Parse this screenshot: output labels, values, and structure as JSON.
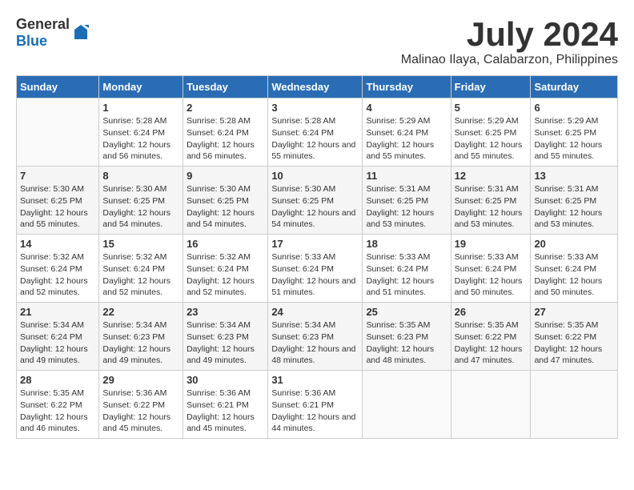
{
  "header": {
    "logo": {
      "general": "General",
      "blue": "Blue"
    },
    "title": "July 2024",
    "subtitle": "Malinao Ilaya, Calabarzon, Philippines"
  },
  "calendar": {
    "days_of_week": [
      "Sunday",
      "Monday",
      "Tuesday",
      "Wednesday",
      "Thursday",
      "Friday",
      "Saturday"
    ],
    "weeks": [
      [
        {
          "day": "",
          "sunrise": "",
          "sunset": "",
          "daylight": ""
        },
        {
          "day": "1",
          "sunrise": "Sunrise: 5:28 AM",
          "sunset": "Sunset: 6:24 PM",
          "daylight": "Daylight: 12 hours and 56 minutes."
        },
        {
          "day": "2",
          "sunrise": "Sunrise: 5:28 AM",
          "sunset": "Sunset: 6:24 PM",
          "daylight": "Daylight: 12 hours and 56 minutes."
        },
        {
          "day": "3",
          "sunrise": "Sunrise: 5:28 AM",
          "sunset": "Sunset: 6:24 PM",
          "daylight": "Daylight: 12 hours and 55 minutes."
        },
        {
          "day": "4",
          "sunrise": "Sunrise: 5:29 AM",
          "sunset": "Sunset: 6:24 PM",
          "daylight": "Daylight: 12 hours and 55 minutes."
        },
        {
          "day": "5",
          "sunrise": "Sunrise: 5:29 AM",
          "sunset": "Sunset: 6:25 PM",
          "daylight": "Daylight: 12 hours and 55 minutes."
        },
        {
          "day": "6",
          "sunrise": "Sunrise: 5:29 AM",
          "sunset": "Sunset: 6:25 PM",
          "daylight": "Daylight: 12 hours and 55 minutes."
        }
      ],
      [
        {
          "day": "7",
          "sunrise": "Sunrise: 5:30 AM",
          "sunset": "Sunset: 6:25 PM",
          "daylight": "Daylight: 12 hours and 55 minutes."
        },
        {
          "day": "8",
          "sunrise": "Sunrise: 5:30 AM",
          "sunset": "Sunset: 6:25 PM",
          "daylight": "Daylight: 12 hours and 54 minutes."
        },
        {
          "day": "9",
          "sunrise": "Sunrise: 5:30 AM",
          "sunset": "Sunset: 6:25 PM",
          "daylight": "Daylight: 12 hours and 54 minutes."
        },
        {
          "day": "10",
          "sunrise": "Sunrise: 5:30 AM",
          "sunset": "Sunset: 6:25 PM",
          "daylight": "Daylight: 12 hours and 54 minutes."
        },
        {
          "day": "11",
          "sunrise": "Sunrise: 5:31 AM",
          "sunset": "Sunset: 6:25 PM",
          "daylight": "Daylight: 12 hours and 53 minutes."
        },
        {
          "day": "12",
          "sunrise": "Sunrise: 5:31 AM",
          "sunset": "Sunset: 6:25 PM",
          "daylight": "Daylight: 12 hours and 53 minutes."
        },
        {
          "day": "13",
          "sunrise": "Sunrise: 5:31 AM",
          "sunset": "Sunset: 6:25 PM",
          "daylight": "Daylight: 12 hours and 53 minutes."
        }
      ],
      [
        {
          "day": "14",
          "sunrise": "Sunrise: 5:32 AM",
          "sunset": "Sunset: 6:24 PM",
          "daylight": "Daylight: 12 hours and 52 minutes."
        },
        {
          "day": "15",
          "sunrise": "Sunrise: 5:32 AM",
          "sunset": "Sunset: 6:24 PM",
          "daylight": "Daylight: 12 hours and 52 minutes."
        },
        {
          "day": "16",
          "sunrise": "Sunrise: 5:32 AM",
          "sunset": "Sunset: 6:24 PM",
          "daylight": "Daylight: 12 hours and 52 minutes."
        },
        {
          "day": "17",
          "sunrise": "Sunrise: 5:33 AM",
          "sunset": "Sunset: 6:24 PM",
          "daylight": "Daylight: 12 hours and 51 minutes."
        },
        {
          "day": "18",
          "sunrise": "Sunrise: 5:33 AM",
          "sunset": "Sunset: 6:24 PM",
          "daylight": "Daylight: 12 hours and 51 minutes."
        },
        {
          "day": "19",
          "sunrise": "Sunrise: 5:33 AM",
          "sunset": "Sunset: 6:24 PM",
          "daylight": "Daylight: 12 hours and 50 minutes."
        },
        {
          "day": "20",
          "sunrise": "Sunrise: 5:33 AM",
          "sunset": "Sunset: 6:24 PM",
          "daylight": "Daylight: 12 hours and 50 minutes."
        }
      ],
      [
        {
          "day": "21",
          "sunrise": "Sunrise: 5:34 AM",
          "sunset": "Sunset: 6:24 PM",
          "daylight": "Daylight: 12 hours and 49 minutes."
        },
        {
          "day": "22",
          "sunrise": "Sunrise: 5:34 AM",
          "sunset": "Sunset: 6:23 PM",
          "daylight": "Daylight: 12 hours and 49 minutes."
        },
        {
          "day": "23",
          "sunrise": "Sunrise: 5:34 AM",
          "sunset": "Sunset: 6:23 PM",
          "daylight": "Daylight: 12 hours and 49 minutes."
        },
        {
          "day": "24",
          "sunrise": "Sunrise: 5:34 AM",
          "sunset": "Sunset: 6:23 PM",
          "daylight": "Daylight: 12 hours and 48 minutes."
        },
        {
          "day": "25",
          "sunrise": "Sunrise: 5:35 AM",
          "sunset": "Sunset: 6:23 PM",
          "daylight": "Daylight: 12 hours and 48 minutes."
        },
        {
          "day": "26",
          "sunrise": "Sunrise: 5:35 AM",
          "sunset": "Sunset: 6:22 PM",
          "daylight": "Daylight: 12 hours and 47 minutes."
        },
        {
          "day": "27",
          "sunrise": "Sunrise: 5:35 AM",
          "sunset": "Sunset: 6:22 PM",
          "daylight": "Daylight: 12 hours and 47 minutes."
        }
      ],
      [
        {
          "day": "28",
          "sunrise": "Sunrise: 5:35 AM",
          "sunset": "Sunset: 6:22 PM",
          "daylight": "Daylight: 12 hours and 46 minutes."
        },
        {
          "day": "29",
          "sunrise": "Sunrise: 5:36 AM",
          "sunset": "Sunset: 6:22 PM",
          "daylight": "Daylight: 12 hours and 45 minutes."
        },
        {
          "day": "30",
          "sunrise": "Sunrise: 5:36 AM",
          "sunset": "Sunset: 6:21 PM",
          "daylight": "Daylight: 12 hours and 45 minutes."
        },
        {
          "day": "31",
          "sunrise": "Sunrise: 5:36 AM",
          "sunset": "Sunset: 6:21 PM",
          "daylight": "Daylight: 12 hours and 44 minutes."
        },
        {
          "day": "",
          "sunrise": "",
          "sunset": "",
          "daylight": ""
        },
        {
          "day": "",
          "sunrise": "",
          "sunset": "",
          "daylight": ""
        },
        {
          "day": "",
          "sunrise": "",
          "sunset": "",
          "daylight": ""
        }
      ]
    ]
  }
}
